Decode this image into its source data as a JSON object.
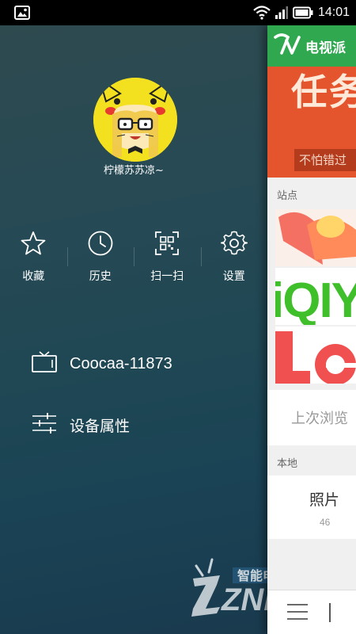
{
  "status_bar": {
    "time": "14:01",
    "icons": [
      "image-notification-icon",
      "wifi-icon",
      "signal-icon",
      "battery-icon"
    ]
  },
  "drawer": {
    "username": "柠檬苏苏凉~",
    "actions": [
      {
        "label": "收藏",
        "icon": "star-icon"
      },
      {
        "label": "历史",
        "icon": "clock-icon"
      },
      {
        "label": "扫一扫",
        "icon": "qr-scan-icon"
      },
      {
        "label": "设置",
        "icon": "gear-icon"
      }
    ],
    "menu": [
      {
        "label": "Coocaa-11873",
        "icon": "tv-icon"
      },
      {
        "label": "设备属性",
        "icon": "sliders-icon"
      }
    ],
    "colors": {
      "background_top": "#2e4a4f",
      "background_bottom": "#1a3a4e",
      "text": "#ffffff"
    }
  },
  "main": {
    "app_title": "电视派",
    "banner": {
      "big_text": "任务",
      "sub_text": "不怕错过"
    },
    "sites_label": "站点",
    "recent_label": "上次浏览",
    "local_label": "本地",
    "local_item": {
      "name": "照片",
      "count": "46"
    },
    "colors": {
      "header": "#2fa84f",
      "banner": "#e4552e"
    }
  },
  "watermark": {
    "text": "智能电视网",
    "brand": "ZNDS"
  }
}
